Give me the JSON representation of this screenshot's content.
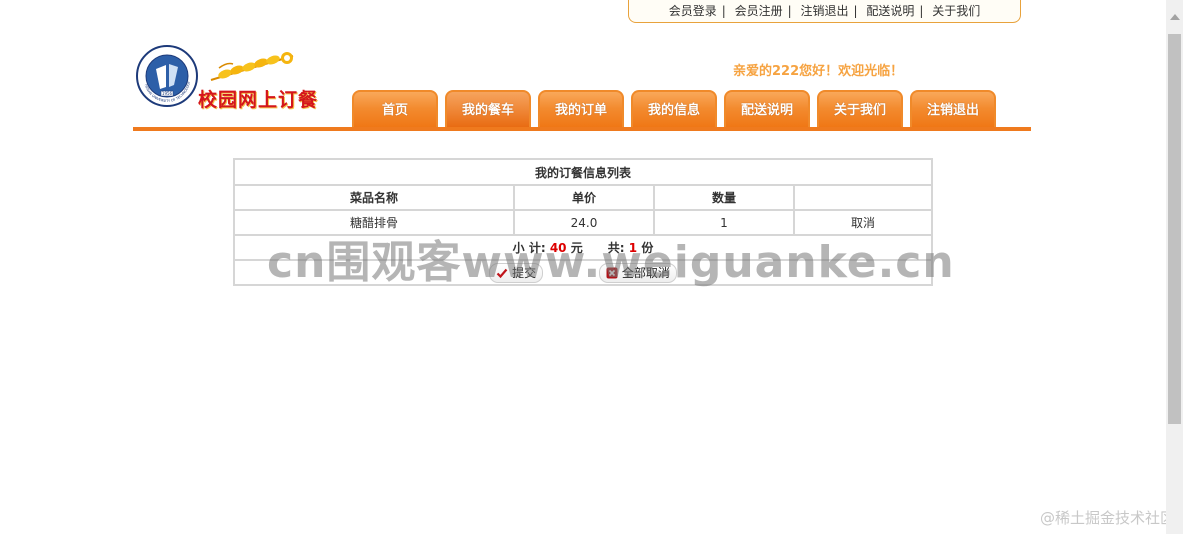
{
  "top_links": [
    "会员登录",
    "会员注册",
    "注销退出",
    "配送说明",
    "关于我们"
  ],
  "logo": {
    "site_name": "校园网上订餐",
    "seal_text": "HENAN UNIVERSITY OF TECHNOLOGY",
    "seal_year": "1956"
  },
  "welcome": "亲爱的222您好！欢迎光临！",
  "nav_tabs": [
    "首页",
    "我的餐车",
    "我的订单",
    "我的信息",
    "配送说明",
    "关于我们",
    "注销退出"
  ],
  "nav_active": "我的餐车",
  "table": {
    "caption": "我的订餐信息列表",
    "headers": [
      "菜品名称",
      "单价",
      "数量",
      ""
    ],
    "rows": [
      {
        "name": "糖醋排骨",
        "price": "24.0",
        "qty": "1",
        "action": "取消"
      }
    ],
    "summary": {
      "subtotal_label": "小 计:",
      "subtotal_value": "40",
      "subtotal_unit": "元",
      "count_label": "共:",
      "count_value": "1",
      "count_unit": "份"
    },
    "submit_label": "提交",
    "cancel_all_label": "全部取消"
  },
  "watermark": "cn围观客www.weiguanke.cn",
  "corner_watermark": "@稀土掘金技术社区",
  "colors": {
    "accent": "#ef7a1e",
    "welcome": "#f6a341",
    "logo_red": "#d4161c",
    "money_red": "#dd0000"
  }
}
